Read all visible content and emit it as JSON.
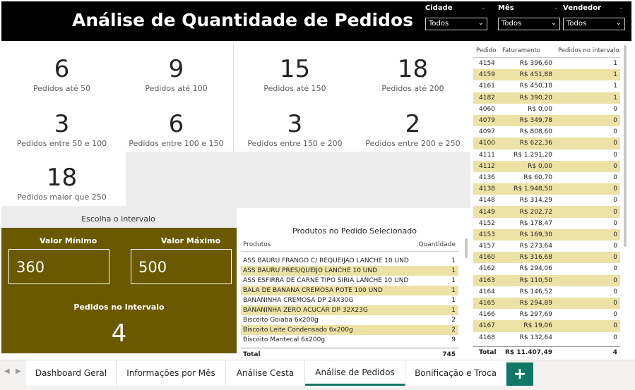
{
  "title": "Análise de Quantidade de Pedidos",
  "slicers": [
    {
      "label": "Cidade",
      "value": "Todos"
    },
    {
      "label": "Mês",
      "value": "Todos"
    },
    {
      "label": "Vendedor",
      "value": "Todos"
    }
  ],
  "cards": [
    {
      "num": "6",
      "sub": "Pedidos até 50"
    },
    {
      "num": "9",
      "sub": "Pedidos até 100"
    },
    {
      "num": "15",
      "sub": "Pedidos até 150"
    },
    {
      "num": "18",
      "sub": "Pedidos até 200"
    },
    {
      "num": "3",
      "sub": "Pedidos entre 50 e 100"
    },
    {
      "num": "6",
      "sub": "Pedidos entre 100 e 150"
    },
    {
      "num": "3",
      "sub": "Pedidos entre 150 e 200"
    },
    {
      "num": "2",
      "sub": "Pedidos entre 200 e 250"
    },
    {
      "num": "18",
      "sub": "Pedidos maior que 250"
    }
  ],
  "interval": {
    "heading": "Escolha o intervalo",
    "min_label": "Valor Mínimo",
    "min_value": "360",
    "max_label": "Valor Máximo",
    "max_value": "500",
    "count_label": "Pedidos no Intervalo",
    "count": "4"
  },
  "products": {
    "title": "Produtos no Pedido Selecionado",
    "col_product": "Produtos",
    "col_qty": "Quantidade",
    "rows": [
      {
        "p": "ASS BAURU FRANGO C/ REQUEIJAO LANCHE 10 UND",
        "q": "1"
      },
      {
        "p": "ASS BAURU PRES/QUEIJO LANCHE 10 UND",
        "q": "1"
      },
      {
        "p": "ASS ESFIRRA DE CARNE TIPO SIRIA LANCHE 10 UND",
        "q": "1"
      },
      {
        "p": "BALA DE BANANA CREMOSA POTE 100 UND",
        "q": "1"
      },
      {
        "p": "BANANINHA CREMOSA DP 24X30G",
        "q": "1"
      },
      {
        "p": "BANANINHA ZERO ACUCAR DP 32X23G",
        "q": "1"
      },
      {
        "p": "Biscoito Goiaba 6x200g",
        "q": "2"
      },
      {
        "p": "Biscoito Leite Condensado 6x200g",
        "q": "2"
      },
      {
        "p": "Biscoito Mantecal 6x200g",
        "q": "9"
      }
    ],
    "total_label": "Total",
    "total_value": "745"
  },
  "orders": {
    "col_pedido": "Pedido",
    "col_fat": "Faturamento",
    "col_int": "Pedidos no intervalo",
    "rows": [
      {
        "p": "4154",
        "f": "R$ 396,60",
        "i": "1"
      },
      {
        "p": "4159",
        "f": "R$ 451,88",
        "i": "1"
      },
      {
        "p": "4161",
        "f": "R$ 450,18",
        "i": "1"
      },
      {
        "p": "4182",
        "f": "R$ 390,20",
        "i": "1"
      },
      {
        "p": "4060",
        "f": "R$ 0,00",
        "i": "0"
      },
      {
        "p": "4079",
        "f": "R$ 349,78",
        "i": "0"
      },
      {
        "p": "4097",
        "f": "R$ 808,60",
        "i": "0"
      },
      {
        "p": "4100",
        "f": "R$ 622,36",
        "i": "0"
      },
      {
        "p": "4111",
        "f": "R$ 1.291,20",
        "i": "0"
      },
      {
        "p": "4112",
        "f": "R$ 0,00",
        "i": "0"
      },
      {
        "p": "4136",
        "f": "R$ 60,70",
        "i": "0"
      },
      {
        "p": "4138",
        "f": "R$ 1.948,50",
        "i": "0"
      },
      {
        "p": "4148",
        "f": "R$ 314,29",
        "i": "0"
      },
      {
        "p": "4149",
        "f": "R$ 202,72",
        "i": "0"
      },
      {
        "p": "4152",
        "f": "R$ 178,47",
        "i": "0"
      },
      {
        "p": "4153",
        "f": "R$ 169,30",
        "i": "0"
      },
      {
        "p": "4157",
        "f": "R$ 273,64",
        "i": "0"
      },
      {
        "p": "4160",
        "f": "R$ 316,68",
        "i": "0"
      },
      {
        "p": "4162",
        "f": "R$ 294,06",
        "i": "0"
      },
      {
        "p": "4163",
        "f": "R$ 110,50",
        "i": "0"
      },
      {
        "p": "4164",
        "f": "R$ 146,52",
        "i": "0"
      },
      {
        "p": "4165",
        "f": "R$ 294,89",
        "i": "0"
      },
      {
        "p": "4166",
        "f": "R$ 297,69",
        "i": "0"
      },
      {
        "p": "4167",
        "f": "R$ 19,06",
        "i": "0"
      },
      {
        "p": "4168",
        "f": "R$ 132,64",
        "i": "0"
      }
    ],
    "total_label": "Total",
    "total_fat": "R$ 11.407,49",
    "total_int": "4"
  },
  "tabs": [
    "Dashboard Geral",
    "Informações por Mês",
    "Análise Cesta",
    "Análise de Pedidos",
    "Bonificação e Troca"
  ],
  "active_tab": "Análise de Pedidos",
  "add_tab_label": "+"
}
